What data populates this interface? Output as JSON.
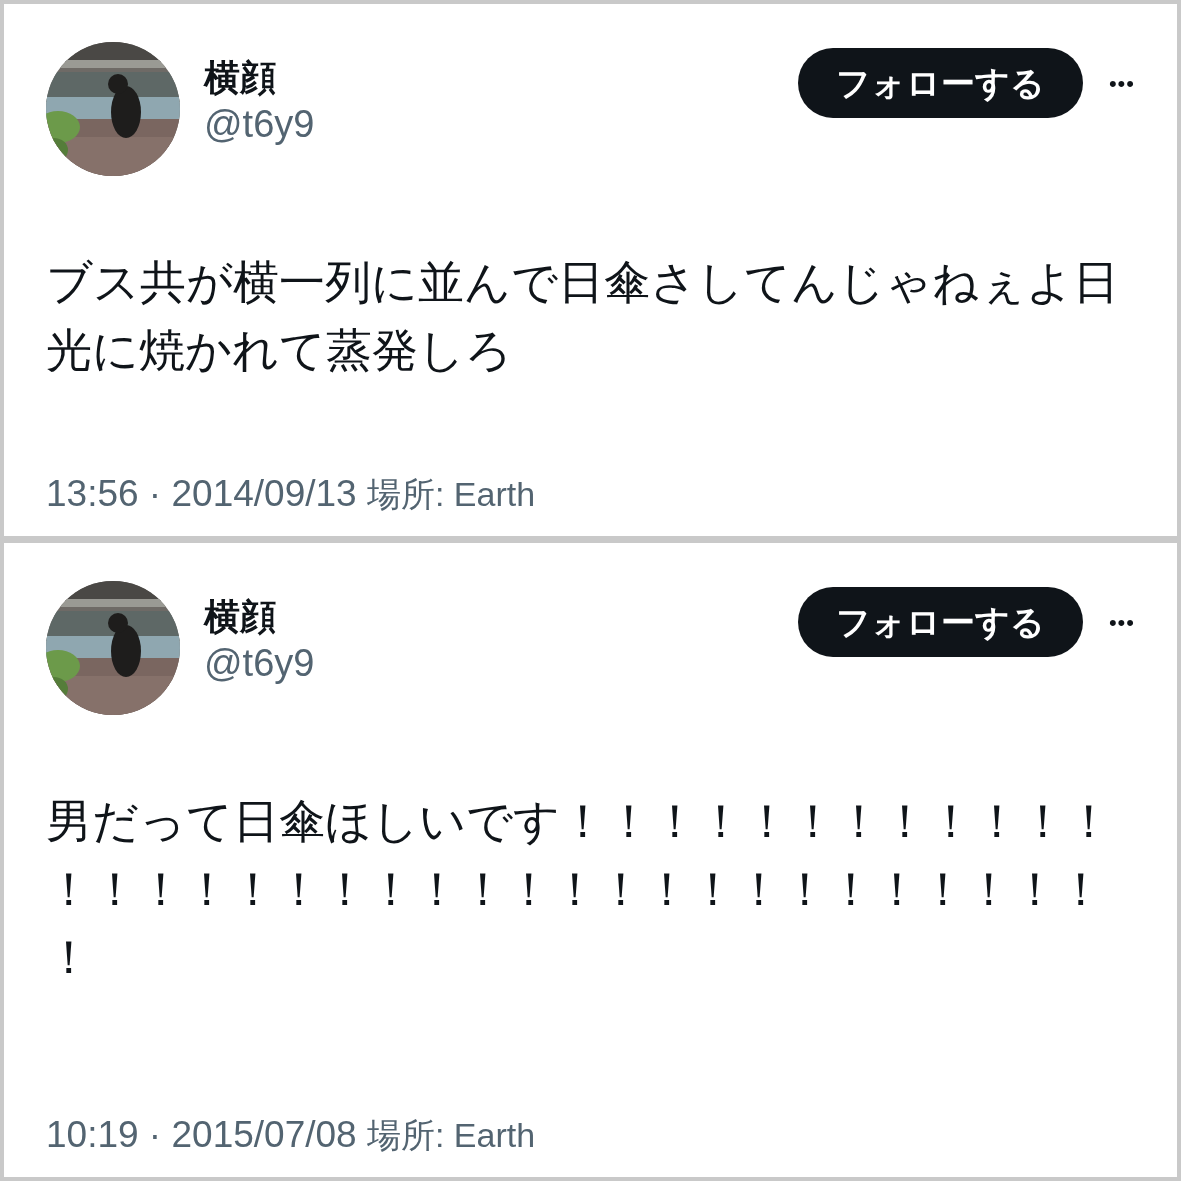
{
  "tweets": [
    {
      "name": "横顔",
      "handle": "@t6y9",
      "follow_button": "フォローする",
      "more": "•••",
      "text": "ブス共が横一列に並んで日傘さしてんじゃねぇよ日光に焼かれて蒸発しろ",
      "time": "13:56 · 2014/09/13",
      "place_label": "場所: Earth"
    },
    {
      "name": "横顔",
      "handle": "@t6y9",
      "follow_button": "フォローする",
      "more": "•••",
      "text": "男だって日傘ほしいです！！！！！！！！！！！！！！！！！！！！！！！！！！！！！！！！！！！！",
      "time": "10:19 · 2015/07/08",
      "place_label": "場所: Earth"
    }
  ]
}
